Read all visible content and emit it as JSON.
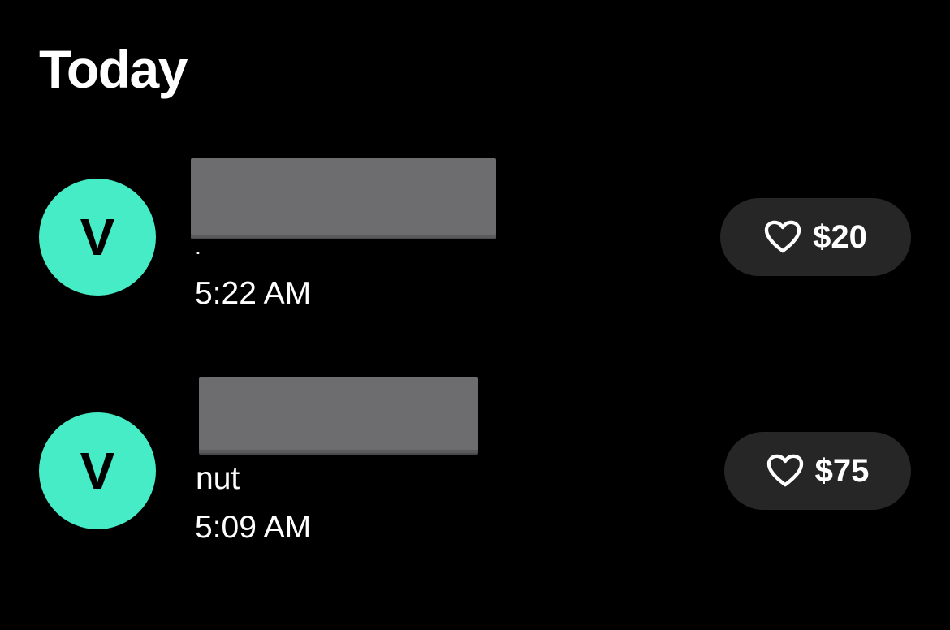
{
  "section": {
    "title": "Today"
  },
  "transactions": [
    {
      "avatar_initial": "V",
      "note": ".",
      "time": "5:22 AM",
      "amount": "$20"
    },
    {
      "avatar_initial": "V",
      "note": "nut",
      "time": "5:09 AM",
      "amount": "$75"
    }
  ],
  "colors": {
    "avatar": "#45ecc6",
    "pill": "#262626",
    "redaction": "#6d6d6f"
  },
  "icons": {
    "like": "heart-outline-icon"
  }
}
